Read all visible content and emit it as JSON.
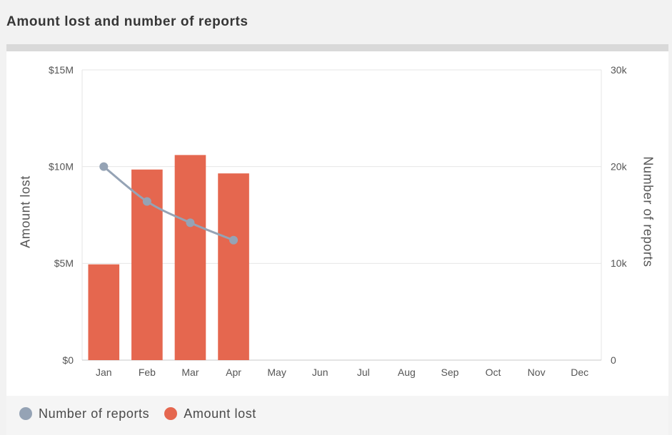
{
  "chart_data": {
    "type": "bar",
    "title": "Amount lost and number of reports",
    "categories": [
      "Jan",
      "Feb",
      "Mar",
      "Apr",
      "May",
      "Jun",
      "Jul",
      "Aug",
      "Sep",
      "Oct",
      "Nov",
      "Dec"
    ],
    "series": [
      {
        "name": "Number of reports",
        "type": "line",
        "y_axis": "right",
        "smooth": true,
        "color": "#95a3b5",
        "values": [
          20000,
          16400,
          14200,
          12400,
          null,
          null,
          null,
          null,
          null,
          null,
          null,
          null
        ]
      },
      {
        "name": "Amount lost",
        "type": "bar",
        "y_axis": "left",
        "color": "#e5674f",
        "values": [
          4950000,
          9850000,
          10600000,
          9650000,
          null,
          null,
          null,
          null,
          null,
          null,
          null,
          null
        ]
      }
    ],
    "y_left": {
      "label": "Amount lost",
      "range": [
        0,
        15000000
      ],
      "ticks": [
        0,
        5000000,
        10000000,
        15000000
      ],
      "tick_labels": [
        "$0",
        "$5M",
        "$10M",
        "$15M"
      ]
    },
    "y_right": {
      "label": "Number of reports",
      "range": [
        0,
        30000
      ],
      "ticks": [
        0,
        10000,
        20000,
        30000
      ],
      "tick_labels": [
        "0",
        "10k",
        "20k",
        "30k"
      ]
    },
    "grid": true,
    "legend": {
      "position": "bottom-left"
    }
  }
}
